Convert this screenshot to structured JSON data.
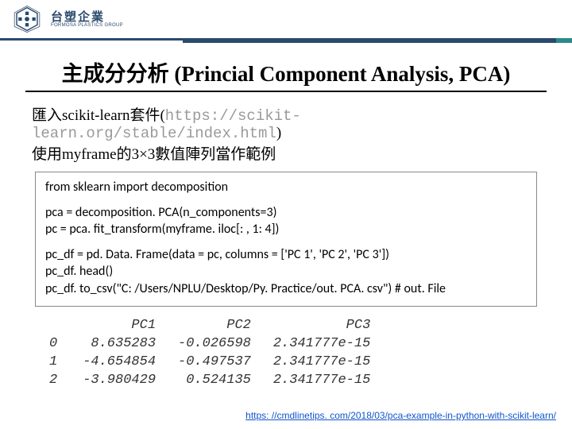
{
  "logo": {
    "cn": "台塑企業",
    "en": "FORMOSA PLASTICS GROUP"
  },
  "title": "主成分分析 (Princial Component Analysis, PCA)",
  "intro": {
    "line1_prefix": "匯入scikit-learn套件(",
    "line1_url": "https://scikit-learn.org/stable/index.html",
    "line1_suffix": ")",
    "line2": "使用myframe的3×3數值陣列當作範例"
  },
  "code": {
    "b1_l1": "from sklearn import decomposition",
    "b2_l1": "pca = decomposition. PCA(n_components=3)",
    "b2_l2": "pc = pca. fit_transform(myframe. iloc[: , 1: 4])",
    "b3_l1": "pc_df = pd. Data. Frame(data = pc, columns = ['PC 1', 'PC 2', 'PC 3'])",
    "b3_l2": "pc_df. head()",
    "b3_l3": "pc_df. to_csv(\"C: /Users/NPLU/Desktop/Py. Practice/out. PCA. csv\")    # out. File"
  },
  "table": {
    "headers": [
      "PC1",
      "PC2",
      "PC3"
    ],
    "rows": [
      {
        "idx": "0",
        "c1": "8.635283",
        "c2": "-0.026598",
        "c3": "2.341777e-15"
      },
      {
        "idx": "1",
        "c1": "-4.654854",
        "c2": "-0.497537",
        "c3": "2.341777e-15"
      },
      {
        "idx": "2",
        "c1": "-3.980429",
        "c2": "0.524135",
        "c3": "2.341777e-15"
      }
    ]
  },
  "footer_link": "https: //cmdlinetips. com/2018/03/pca-example-in-python-with-scikit-learn/"
}
